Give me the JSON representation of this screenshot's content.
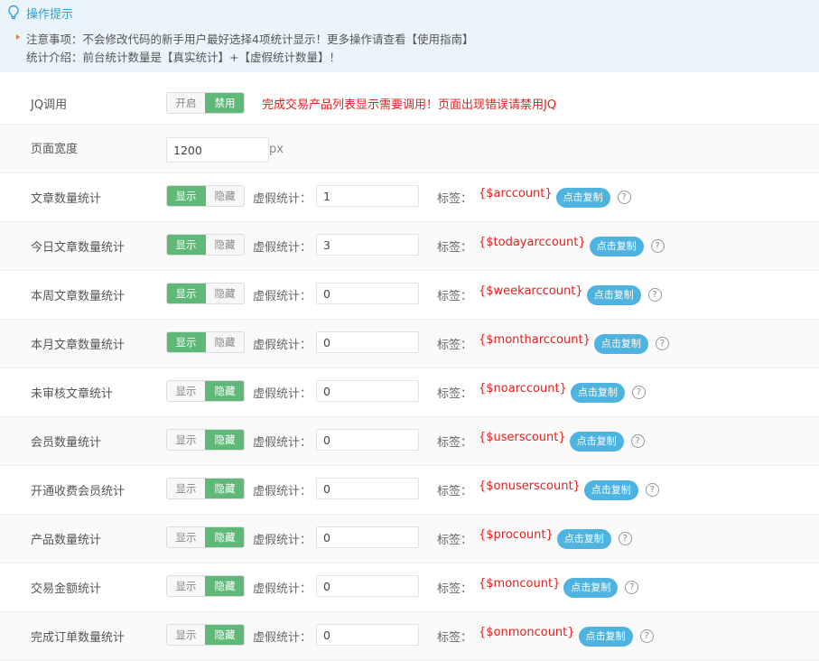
{
  "tips": {
    "title": "操作提示",
    "line1": "注意事项：不会修改代码的新手用户最好选择4项统计显示！更多操作请查看【使用指南】",
    "line2": "统计介绍：前台统计数量是【真实统计】+【虚假统计数量】！"
  },
  "jq": {
    "label": "JQ调用",
    "options": [
      "开启",
      "禁用"
    ],
    "selected": "禁用",
    "note": "完成交易产品列表显示需要调用！页面出现错误请禁用JQ"
  },
  "width": {
    "label": "页面宽度",
    "value": "1200",
    "unit": "px"
  },
  "common": {
    "show": "显示",
    "hide": "隐藏",
    "fake_label": "虚假统计：",
    "tag_label": "标签：",
    "copy": "点击复制",
    "help": "?"
  },
  "stats": [
    {
      "label": "文章数量统计",
      "state": "显示",
      "fake": "1",
      "tag": "{$arccount}"
    },
    {
      "label": "今日文章数量统计",
      "state": "显示",
      "fake": "3",
      "tag": "{$todayarccount}"
    },
    {
      "label": "本周文章数量统计",
      "state": "显示",
      "fake": "0",
      "tag": "{$weekarccount}"
    },
    {
      "label": "本月文章数量统计",
      "state": "显示",
      "fake": "0",
      "tag": "{$montharccount}"
    },
    {
      "label": "未审核文章统计",
      "state": "隐藏",
      "fake": "0",
      "tag": "{$noarccount}"
    },
    {
      "label": "会员数量统计",
      "state": "隐藏",
      "fake": "0",
      "tag": "{$userscount}"
    },
    {
      "label": "开通收费会员统计",
      "state": "隐藏",
      "fake": "0",
      "tag": "{$onuserscount}"
    },
    {
      "label": "产品数量统计",
      "state": "隐藏",
      "fake": "0",
      "tag": "{$procount}"
    },
    {
      "label": "交易金额统计",
      "state": "隐藏",
      "fake": "0",
      "tag": "{$moncount}"
    },
    {
      "label": "完成订单数量统计",
      "state": "隐藏",
      "fake": "0",
      "tag": "{$onmoncount}"
    }
  ],
  "colors": {
    "accent": "#2e9fd8",
    "toggle_on": "#5fb878",
    "tag_red": "#e02020",
    "copy_btn": "#4eb3df",
    "tips_bg": "#e9f5fb"
  }
}
